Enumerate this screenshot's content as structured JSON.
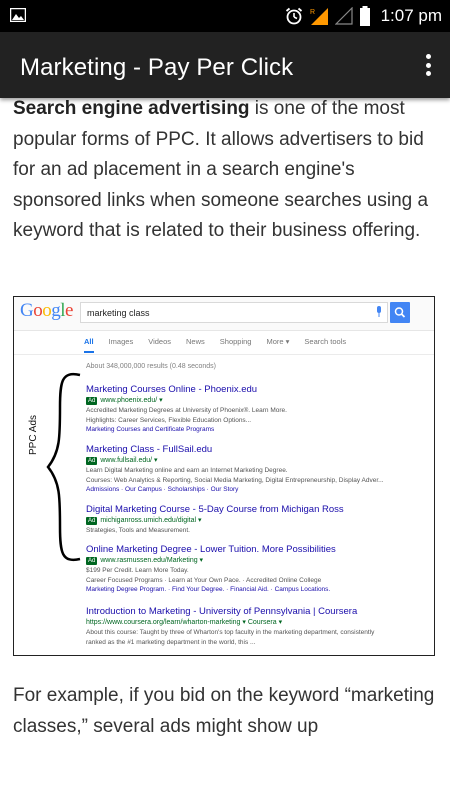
{
  "status_bar": {
    "time": "1:07 pm",
    "icons": [
      "gallery-icon",
      "alarm-icon",
      "signal-icon",
      "battery-icon"
    ],
    "background": "#000000"
  },
  "app_bar": {
    "title": "Marketing - Pay Per Click",
    "menu_icon": "more-vert-icon",
    "background": "#222222"
  },
  "content": {
    "para1_bold": "Search engine advertising",
    "para1_rest": " is one of the most popular forms of PPC. It allows advertisers to bid for an ad placement in a search engine's sponsored links when someone searches using a keyword that is related to their business offering.",
    "para2": "For example, if you bid on the keyword “marketing classes,” several ads might show up"
  },
  "screenshot": {
    "logo_letters": [
      "G",
      "o",
      "o",
      "g",
      "l",
      "e"
    ],
    "search_query": "marketing class",
    "tabs": [
      "All",
      "Images",
      "Videos",
      "News",
      "Shopping",
      "More ▾",
      "Search tools"
    ],
    "stats": "About 348,000,000 results (0.48 seconds)",
    "ppc_label": "PPC Ads",
    "results": [
      {
        "title": "Marketing Courses Online - Phoenix.edu",
        "ad": "Ad",
        "url": "www.phoenix.edu/ ▾",
        "desc": [
          "Accredited Marketing Degrees at University of Phoenix®. Learn More.",
          "Highlights: Career Services, Flexible Education Options..."
        ],
        "links": "Marketing Courses and Certificate Programs"
      },
      {
        "title": "Marketing Class - FullSail.edu",
        "ad": "Ad",
        "url": "www.fullsail.edu/ ▾",
        "desc": [
          "Learn Digital Marketing online and earn an Internet Marketing Degree.",
          "Courses: Web Analytics & Reporting, Social Media Marketing, Digital Entrepreneurship, Display Adver..."
        ],
        "links": "Admissions · Our Campus · Scholarships · Our Story"
      },
      {
        "title": "Digital Marketing Course - 5-Day Course from Michigan Ross",
        "ad": "Ad",
        "url": "michiganross.umich.edu/digital ▾",
        "desc": [
          "Strategies, Tools and Measurement."
        ],
        "links": ""
      },
      {
        "title": "Online Marketing Degree - Lower Tuition. More Possibilities",
        "ad": "Ad",
        "url": "www.rasmussen.edu/Marketing ▾",
        "desc": [
          "$199 Per Credit. Learn More Today.",
          "Career Focused Programs · Learn at Your Own Pace. · Accredited Online College"
        ],
        "links": "Marketing Degree Program. · Find Your Degree. · Financial Aid. · Campus Locations."
      },
      {
        "title": "Introduction to Marketing - University of Pennsylvania | Coursera",
        "ad": "",
        "url": "https://www.coursera.org/learn/wharton-marketing ▾  Coursera ▾",
        "desc": [
          "About this course: Taught by three of Wharton's top faculty in the marketing department, consistently",
          "ranked as the #1 marketing department in the world, this ..."
        ],
        "links": ""
      }
    ]
  }
}
